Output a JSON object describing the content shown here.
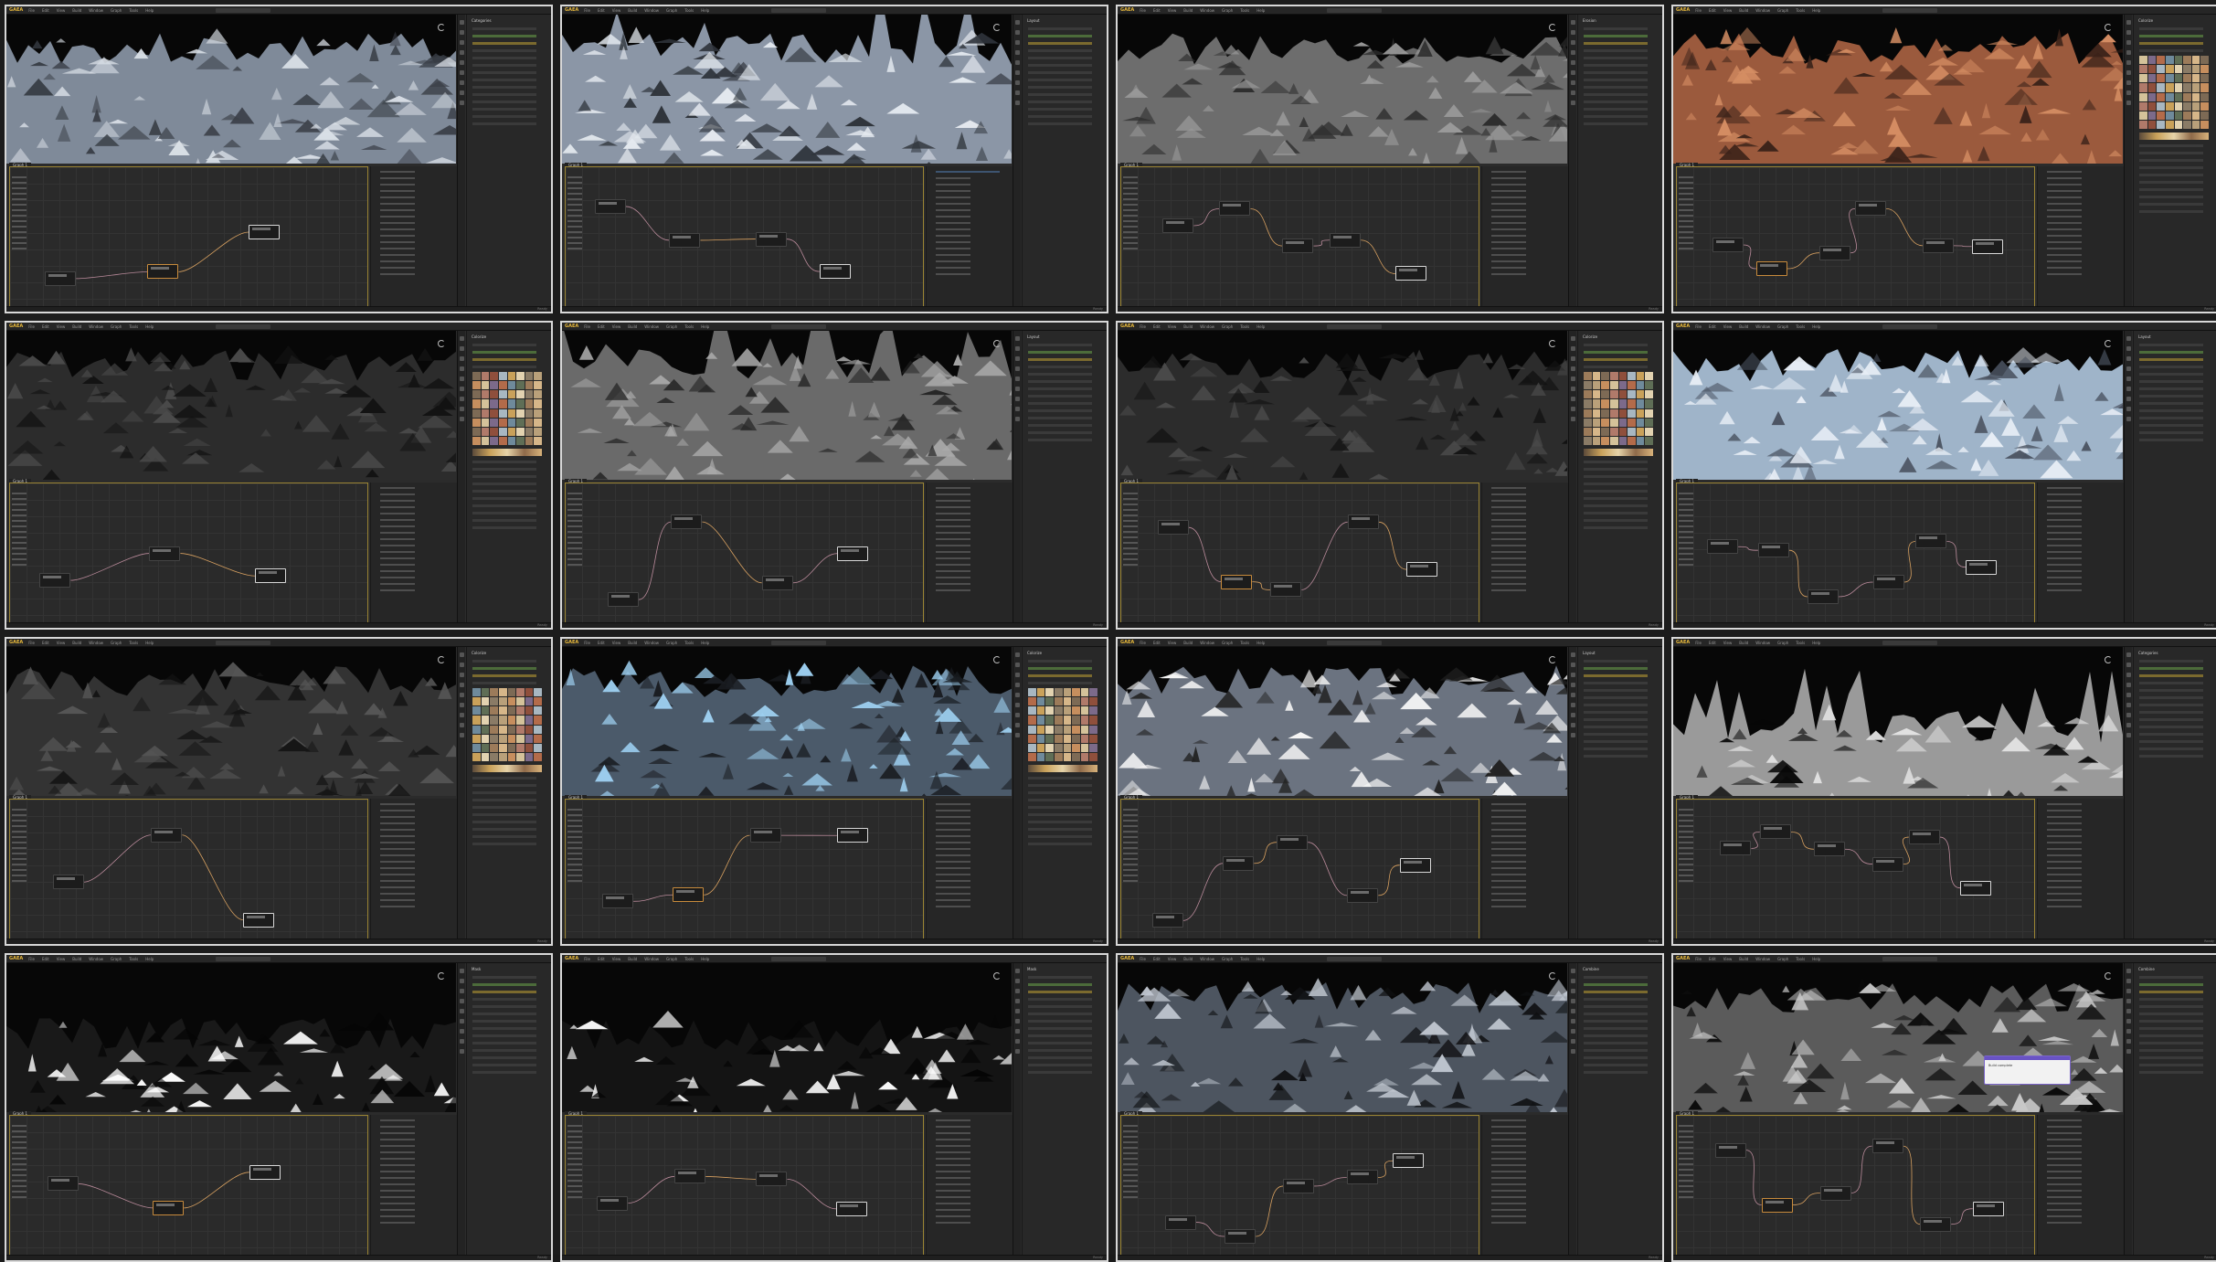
{
  "app": {
    "logo": "GAEA",
    "menu": [
      "File",
      "Edit",
      "View",
      "Build",
      "Window",
      "Graph",
      "Tools",
      "Help"
    ],
    "graph_tab": "Graph 1",
    "status": "Ready"
  },
  "tiles": [
    {
      "terrain": "snow-grey",
      "props_title": "Categories",
      "swatches": false,
      "dialog": false
    },
    {
      "terrain": "snow-grey-spiky",
      "props_title": "Layout",
      "swatches": false,
      "dialog": false
    },
    {
      "terrain": "grey-mono",
      "props_title": "Erosion",
      "swatches": false,
      "dialog": false
    },
    {
      "terrain": "desert-orange",
      "props_title": "Colorize",
      "swatches": true,
      "dialog": false
    },
    {
      "terrain": "dark-rock",
      "props_title": "Colorize",
      "swatches": true,
      "dialog": false
    },
    {
      "terrain": "grey-spiky",
      "props_title": "Layout",
      "swatches": false,
      "dialog": false
    },
    {
      "terrain": "dark-rock",
      "props_title": "Colorize",
      "swatches": true,
      "dialog": false
    },
    {
      "terrain": "snow-blue",
      "props_title": "Layout",
      "swatches": false,
      "dialog": false
    },
    {
      "terrain": "dark-rock-2",
      "props_title": "Colorize",
      "swatches": true,
      "dialog": false
    },
    {
      "terrain": "ice-blue",
      "props_title": "Colorize",
      "swatches": true,
      "dialog": false
    },
    {
      "terrain": "snow-patch",
      "props_title": "Layout",
      "swatches": false,
      "dialog": false
    },
    {
      "terrain": "island-spiky",
      "props_title": "Categories",
      "swatches": false,
      "dialog": false
    },
    {
      "terrain": "mask-white",
      "props_title": "Mask",
      "swatches": false,
      "dialog": false
    },
    {
      "terrain": "mask-white-2",
      "props_title": "Mask",
      "swatches": false,
      "dialog": false
    },
    {
      "terrain": "speckle",
      "props_title": "Combine",
      "swatches": false,
      "dialog": false
    },
    {
      "terrain": "speckle-grey",
      "props_title": "Combine",
      "swatches": false,
      "dialog": true
    }
  ],
  "dialog": {
    "text": "Build complete"
  },
  "colors": {
    "accent": "#e8b93b",
    "graph_border": "#9a8433",
    "wire": "#b98a9a",
    "wire_alt": "#d7a060",
    "dialog_bar": "#6953c4"
  }
}
